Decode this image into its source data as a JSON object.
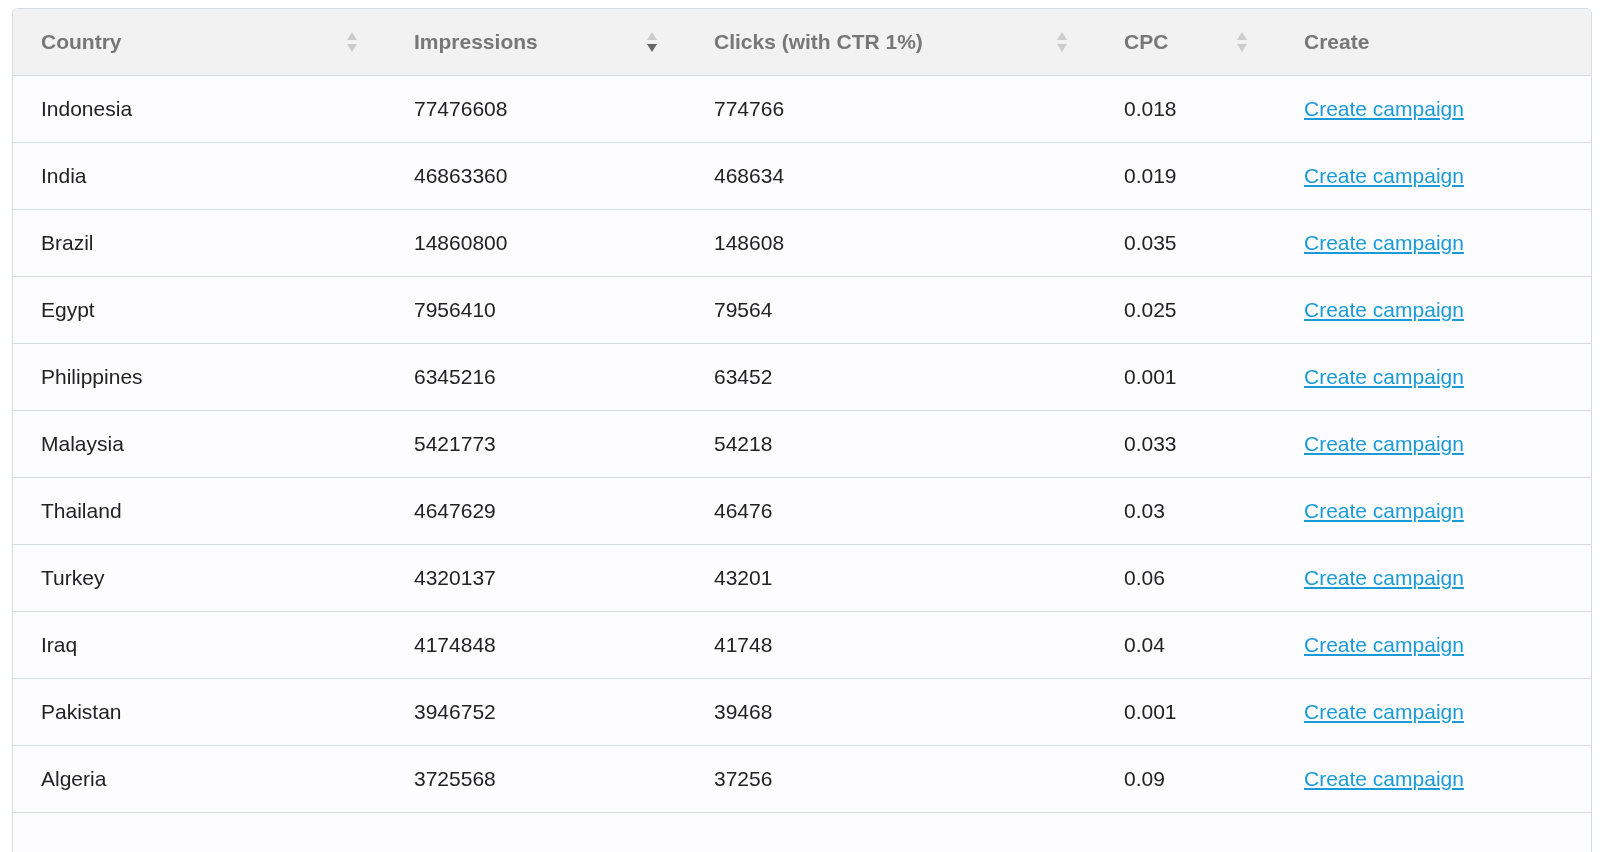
{
  "table": {
    "columns": [
      {
        "label": "Country",
        "sorted": false
      },
      {
        "label": "Impressions",
        "sorted": true
      },
      {
        "label": "Clicks (with CTR 1%)",
        "sorted": false
      },
      {
        "label": "CPC",
        "sorted": false
      },
      {
        "label": "Create"
      }
    ],
    "rows": [
      {
        "country": "Indonesia",
        "impressions": "77476608",
        "clicks": "774766",
        "cpc": "0.018",
        "link": "Create campaign"
      },
      {
        "country": "India",
        "impressions": "46863360",
        "clicks": "468634",
        "cpc": "0.019",
        "link": "Create campaign"
      },
      {
        "country": "Brazil",
        "impressions": "14860800",
        "clicks": "148608",
        "cpc": "0.035",
        "link": "Create campaign"
      },
      {
        "country": "Egypt",
        "impressions": "7956410",
        "clicks": "79564",
        "cpc": "0.025",
        "link": "Create campaign"
      },
      {
        "country": "Philippines",
        "impressions": "6345216",
        "clicks": "63452",
        "cpc": "0.001",
        "link": "Create campaign"
      },
      {
        "country": "Malaysia",
        "impressions": "5421773",
        "clicks": "54218",
        "cpc": "0.033",
        "link": "Create campaign"
      },
      {
        "country": "Thailand",
        "impressions": "4647629",
        "clicks": "46476",
        "cpc": "0.03",
        "link": "Create campaign"
      },
      {
        "country": "Turkey",
        "impressions": "4320137",
        "clicks": "43201",
        "cpc": "0.06",
        "link": "Create campaign"
      },
      {
        "country": "Iraq",
        "impressions": "4174848",
        "clicks": "41748",
        "cpc": "0.04",
        "link": "Create campaign"
      },
      {
        "country": "Pakistan",
        "impressions": "3946752",
        "clicks": "39468",
        "cpc": "0.001",
        "link": "Create campaign"
      },
      {
        "country": "Algeria",
        "impressions": "3725568",
        "clicks": "37256",
        "cpc": "0.09",
        "link": "Create campaign"
      }
    ]
  }
}
